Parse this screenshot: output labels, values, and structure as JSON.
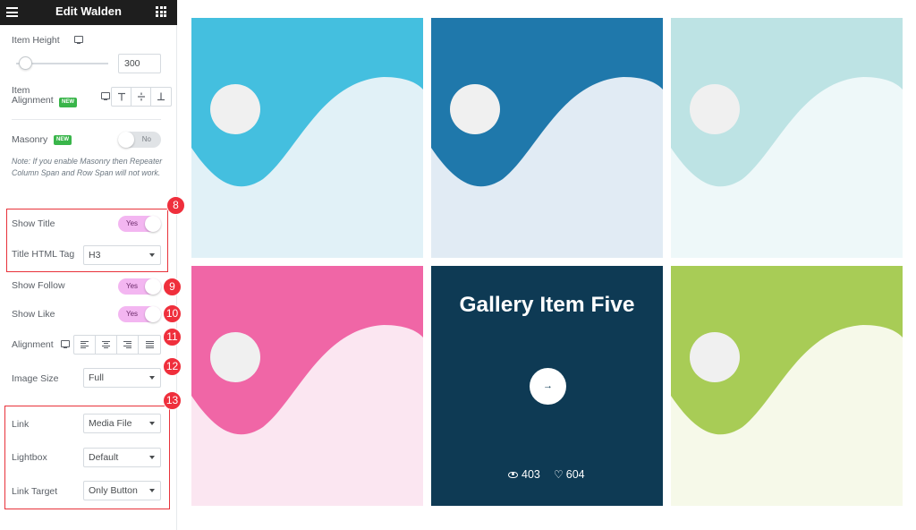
{
  "panel": {
    "title": "Edit Walden",
    "item_height": {
      "label": "Item Height",
      "value": "300",
      "slider_level_percent": 10
    },
    "item_alignment": {
      "label_line1": "Item",
      "label_line2": "Alignment",
      "badge": "NEW"
    },
    "masonry": {
      "label": "Masonry",
      "badge": "NEW",
      "toggle": "No"
    },
    "note": "Note: If you enable Masonry then Repeater Column Span and Row Span will not work.",
    "show_title": {
      "label": "Show Title",
      "toggle": "Yes"
    },
    "title_html_tag": {
      "label": "Title HTML Tag",
      "value": "H3"
    },
    "show_follow": {
      "label": "Show Follow",
      "toggle": "Yes"
    },
    "show_like": {
      "label": "Show Like",
      "toggle": "Yes"
    },
    "alignment": {
      "label": "Alignment"
    },
    "image_size": {
      "label": "Image Size",
      "value": "Full"
    },
    "link": {
      "label": "Link",
      "value": "Media File"
    },
    "lightbox": {
      "label": "Lightbox",
      "value": "Default"
    },
    "link_target": {
      "label": "Link Target",
      "value": "Only Button"
    }
  },
  "markers": [
    "8",
    "9",
    "10",
    "11",
    "12",
    "13"
  ],
  "gallery": {
    "tiles": [
      {
        "bg": "#44bfdf",
        "wave": "#e1f1f7"
      },
      {
        "bg": "#1f78ab",
        "wave": "#e1ebf4"
      },
      {
        "bg": "#bde3e4",
        "wave": "#eef8f9"
      },
      {
        "bg": "#f066a6",
        "wave": "#fbe6f1"
      },
      {
        "bg": "#0e3a54",
        "wave": "#0e3a54"
      },
      {
        "bg": "#a8cc56",
        "wave": "#f6f9e9"
      }
    ],
    "hover": {
      "title": "Gallery Item Five",
      "views": "403",
      "likes": "604",
      "arrow": "→"
    }
  },
  "colors": {
    "accent_red": "#e8323a",
    "toggle_on": "#f3b6f1",
    "topbar": "#1e1e1e",
    "new_badge": "#39b54a"
  }
}
